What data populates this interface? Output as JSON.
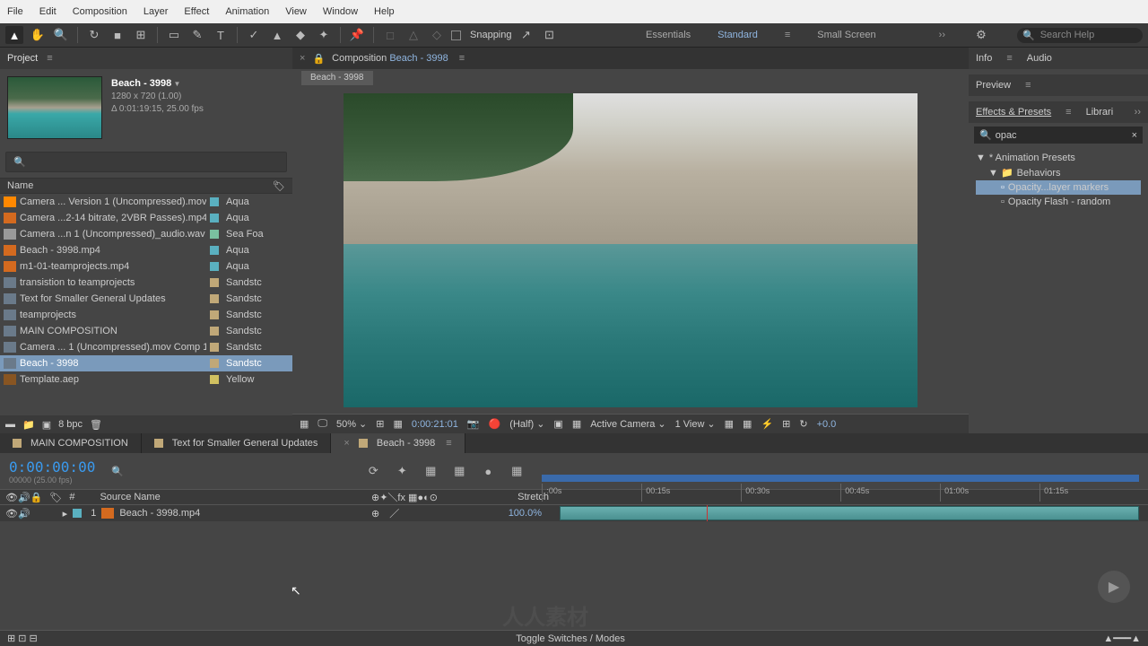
{
  "menu": {
    "items": [
      "File",
      "Edit",
      "Composition",
      "Layer",
      "Effect",
      "Animation",
      "View",
      "Window",
      "Help"
    ]
  },
  "toolbar": {
    "snapping": "Snapping",
    "workspaces": [
      "Essentials",
      "Standard",
      "Small Screen"
    ],
    "active_workspace": 1,
    "search_placeholder": "Search Help"
  },
  "project": {
    "panel_title": "Project",
    "comp_name": "Beach - 3998",
    "dims": "1280 x 720 (1.00)",
    "duration": "Δ 0:01:19:15, 25.00 fps",
    "col_name": "Name",
    "items": [
      {
        "ico": "mov",
        "name": "Camera ... Version 1 (Uncompressed).mov",
        "label": "Aqua",
        "lc": "aqua"
      },
      {
        "ico": "mp4",
        "name": "Camera ...2-14 bitrate, 2VBR Passes).mp4",
        "label": "Aqua",
        "lc": "aqua"
      },
      {
        "ico": "wav",
        "name": "Camera ...n 1 (Uncompressed)_audio.wav",
        "label": "Sea Foa",
        "lc": "seafoam"
      },
      {
        "ico": "mp4",
        "name": "Beach - 3998.mp4",
        "label": "Aqua",
        "lc": "aqua"
      },
      {
        "ico": "mp4",
        "name": "m1-01-teamprojects.mp4",
        "label": "Aqua",
        "lc": "aqua"
      },
      {
        "ico": "comp",
        "name": "transistion to teamprojects",
        "label": "Sandstc",
        "lc": "sandstone"
      },
      {
        "ico": "comp",
        "name": "Text for Smaller General Updates",
        "label": "Sandstc",
        "lc": "sandstone"
      },
      {
        "ico": "comp",
        "name": "teamprojects",
        "label": "Sandstc",
        "lc": "sandstone"
      },
      {
        "ico": "comp",
        "name": "MAIN COMPOSITION",
        "label": "Sandstc",
        "lc": "sandstone"
      },
      {
        "ico": "comp",
        "name": "Camera ... 1 (Uncompressed).mov Comp 1",
        "label": "Sandstc",
        "lc": "sandstone"
      },
      {
        "ico": "comp",
        "name": "Beach - 3998",
        "label": "Sandstc",
        "lc": "sandstone",
        "sel": true
      },
      {
        "ico": "folder",
        "name": "Template.aep",
        "label": "Yellow",
        "lc": "yellow"
      }
    ],
    "footer_bpc": "8 bpc"
  },
  "comp_panel": {
    "tab_prefix": "Composition ",
    "tab_name": "Beach - 3998",
    "breadcrumb": "Beach - 3998"
  },
  "viewer_footer": {
    "zoom": "50%",
    "time": "0:00:21:01",
    "res": "(Half)",
    "camera": "Active Camera",
    "views": "1 View",
    "exposure": "+0.0"
  },
  "right": {
    "info": "Info",
    "audio": "Audio",
    "preview": "Preview",
    "effects": "Effects & Presets",
    "librari": "Librari",
    "search_value": "opac",
    "tree": {
      "presets": "* Animation Presets",
      "behaviors": "Behaviors",
      "item1": "Opacity...layer markers",
      "item2": "Opacity Flash - random"
    }
  },
  "timeline": {
    "tabs": [
      {
        "name": "MAIN COMPOSITION"
      },
      {
        "name": "Text for Smaller General Updates"
      },
      {
        "name": "Beach - 3998",
        "x": true,
        "active": true
      }
    ],
    "timecode": "0:00:00:00",
    "tc_sub": "00000 (25.00 fps)",
    "ticks": [
      ":00s",
      "00:15s",
      "00:30s",
      "00:45s",
      "01:00s",
      "01:15s"
    ],
    "col_num": "#",
    "col_source": "Source Name",
    "col_stretch": "Stretch",
    "layer": {
      "num": "1",
      "name": "Beach - 3998.mp4",
      "stretch": "100.0%"
    },
    "toggle": "Toggle Switches / Modes"
  }
}
